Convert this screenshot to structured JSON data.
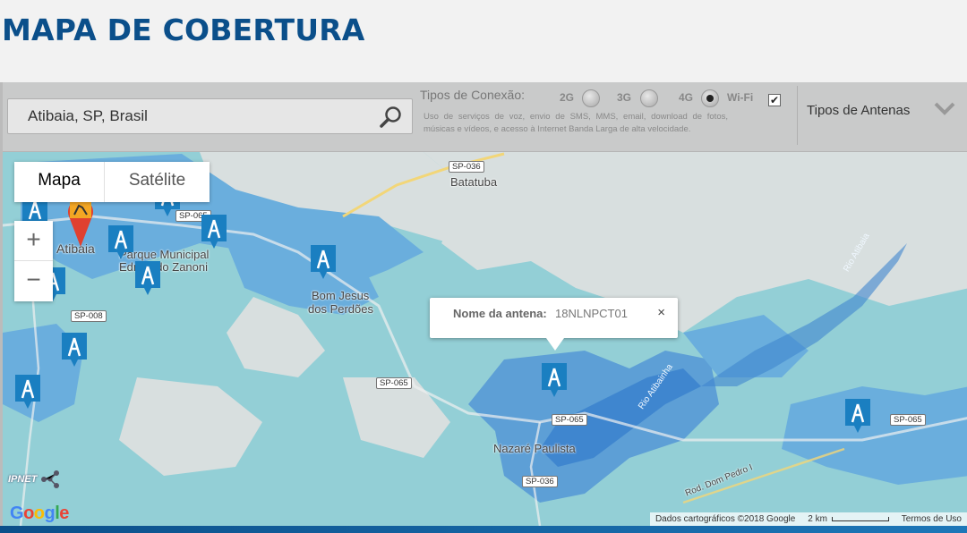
{
  "page": {
    "title": "MAPA DE COBERTURA"
  },
  "search": {
    "value": "Atibaia, SP, Brasil"
  },
  "connection": {
    "label": "Tipos de Conexão:",
    "options": [
      {
        "label": "2G",
        "selected": false
      },
      {
        "label": "3G",
        "selected": false
      },
      {
        "label": "4G",
        "selected": true
      },
      {
        "label": "Wi-Fi",
        "checked": true
      }
    ],
    "description": "Uso de serviços de voz, envio de SMS, MMS, email, download de fotos, músicas e vídeos, e acesso à Internet Banda Larga de alta velocidade."
  },
  "antenna_filter": {
    "label": "Tipos de Antenas"
  },
  "map_type": {
    "map": "Mapa",
    "satellite": "Satélite"
  },
  "zoom": {
    "in": "+",
    "out": "−"
  },
  "places": {
    "batatuba": "Batatuba",
    "atibaia": "Atibaia",
    "parque": "Parque Municipal Edmundo Zanoni",
    "bomjesus1": "Bom Jesus",
    "bomjesus2": "dos Perdões",
    "nazare": "Nazaré Paulista",
    "rio_atibainha": "Rio Atibainha",
    "rio_atibaia": "Rio Atibaia",
    "rod_dom_pedro": "Rod. Dom Pedro I"
  },
  "roads": [
    "SP-036",
    "SP-065",
    "SP-008",
    "SP-065",
    "SP-065",
    "SP-036",
    "SP-065"
  ],
  "popup": {
    "label": "Nome da antena:",
    "value": "18NLNPCT01",
    "close": "×"
  },
  "footer": {
    "data": "Dados cartográficos ©2018 Google",
    "scale": "2 km",
    "terms": "Termos de Uso"
  },
  "logos": {
    "google": "Google",
    "ipnet": "IPNET"
  },
  "colors": {
    "brand": "#0b4f8a",
    "coverage": "#5aa6d8",
    "coverage_light": "#8fd0d8",
    "tower": "#1a7fc1"
  }
}
